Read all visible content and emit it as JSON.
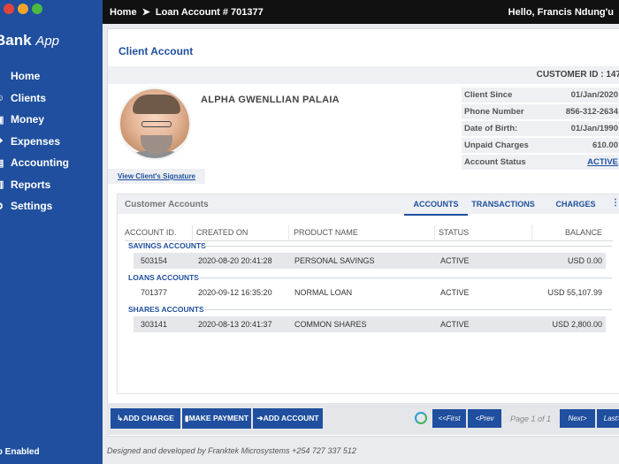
{
  "window": {
    "controls": [
      "close",
      "minimize",
      "maximize"
    ]
  },
  "sidebar": {
    "brand_bold": "Bank",
    "brand_italic": "App",
    "items": [
      {
        "label": "Home",
        "icon": "home-icon"
      },
      {
        "label": "Clients",
        "icon": "users-icon"
      },
      {
        "label": "Money",
        "icon": "money-icon"
      },
      {
        "label": "Expenses",
        "icon": "expenses-icon"
      },
      {
        "label": "Accounting",
        "icon": "accounting-icon"
      },
      {
        "label": "Reports",
        "icon": "reports-icon"
      },
      {
        "label": "Settings",
        "icon": "gear-icon"
      }
    ],
    "footer": "ip Enabled"
  },
  "topbar": {
    "crumb_home": "Home",
    "crumb_sep": "➤",
    "crumb_page": "Loan Account # 701377",
    "greeting": "Hello, Francis Ndung'u"
  },
  "page": {
    "title": "Client Account",
    "customer_id": "CUSTOMER ID : 147"
  },
  "client": {
    "name": "ALPHA GWENLLIAN PALAIA",
    "signature_link": "View Client's Signature",
    "info": [
      {
        "label": "Client Since",
        "value": "01/Jan/2020"
      },
      {
        "label": "Phone Number",
        "value": "856-312-2634"
      },
      {
        "label": "Date of Birth:",
        "value": "01/Jan/1990"
      },
      {
        "label": "Unpaid Charges",
        "value": "610.00"
      },
      {
        "label": "Account Status",
        "value": "ACTIVE"
      }
    ]
  },
  "accounts": {
    "panel_label": "Customer Accounts",
    "tabs": [
      "ACCOUNTS",
      "TRANSACTIONS",
      "CHARGES"
    ],
    "more": "⋮",
    "columns": [
      "ACCOUNT ID.",
      "CREATED ON",
      "PRODUCT NAME",
      "STATUS",
      "BALANCE"
    ],
    "groups": [
      {
        "title": "SAVINGS ACCOUNTS",
        "rows": [
          [
            "503154",
            "2020-08-20 20:41:28",
            "PERSONAL SAVINGS",
            "ACTIVE",
            "USD 0.00"
          ]
        ]
      },
      {
        "title": "LOANS ACCOUNTS",
        "rows": [
          [
            "701377",
            "2020-09-12 16:35:20",
            "NORMAL LOAN",
            "ACTIVE",
            "USD 55,107.99"
          ]
        ]
      },
      {
        "title": "SHARES ACCOUNTS",
        "rows": [
          [
            "303141",
            "2020-08-13 20:41:37",
            "COMMON SHARES",
            "ACTIVE",
            "USD 2,800.00"
          ]
        ]
      }
    ]
  },
  "actions": {
    "add_charge": "ADD CHARGE",
    "make_payment": "MAKE PAYMENT",
    "add_account": "ADD ACCOUNT"
  },
  "pagination": {
    "first": "<<First",
    "prev": "<Prev",
    "info": "Page 1 of 1",
    "next": "Next>",
    "last": "Last>>"
  },
  "footer": "Designed and developed by Franktek Microsystems +254 727 337 512"
}
